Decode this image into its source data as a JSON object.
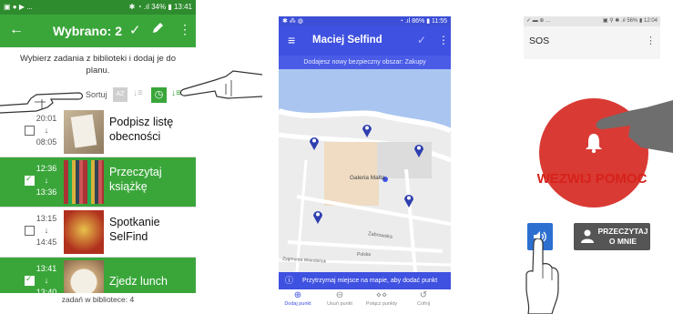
{
  "phone1": {
    "status_time": "13:41",
    "status_battery": "34%",
    "title": "Wybrano: 2",
    "instruction": "Wybierz zadania z biblioteki i dodaj je do planu.",
    "sort_label": "Sortuj",
    "sort_az_label": "AZ",
    "tasks": [
      {
        "start": "20:01",
        "end": "08:05",
        "title": "Podpisz listę obecności",
        "selected": false
      },
      {
        "start": "12:36",
        "end": "13:36",
        "title": "Przeczytaj książkę",
        "selected": true
      },
      {
        "start": "13:15",
        "end": "14:45",
        "title": "Spotkanie SelFind",
        "selected": false
      },
      {
        "start": "13:41",
        "end": "13:40",
        "title": "Zjedz lunch",
        "selected": true
      }
    ],
    "footer": "zadań w bibliotece: 4",
    "colors": {
      "accent": "#3aa63a",
      "statusbar": "#2e8b2e"
    }
  },
  "phone2": {
    "status_time": "11:55",
    "status_battery": "86%",
    "title": "Maciej Selfind",
    "subtitle": "Dodajesz nowy bezpieczny obszar: Zakupy",
    "map_label": "Galeria Malta",
    "street_labels": [
      "Zabrowska",
      "Zygmunta Wierzbińsk",
      "Polska"
    ],
    "hint": "Przytrzymaj miejsce na mapie, aby dodać punkt",
    "nav": [
      {
        "label": "Dodaj punkt",
        "icon": "add-location-icon",
        "active": true
      },
      {
        "label": "Usuń punkt",
        "icon": "remove-location-icon",
        "active": false
      },
      {
        "label": "Połącz punkty",
        "icon": "connect-points-icon",
        "active": false
      },
      {
        "label": "Cofnij",
        "icon": "undo-icon",
        "active": false
      }
    ],
    "colors": {
      "accent": "#3f51e0",
      "pin": "#2f3fb0"
    }
  },
  "phone3": {
    "status_time": "12:04",
    "status_battery": "56%",
    "title": "SOS",
    "call_help": "WEZWIJ POMOC",
    "about_me": "PRZECZYTAJ O MNIE",
    "colors": {
      "alarm": "#d93a34",
      "speaker": "#2c6fd1"
    }
  }
}
